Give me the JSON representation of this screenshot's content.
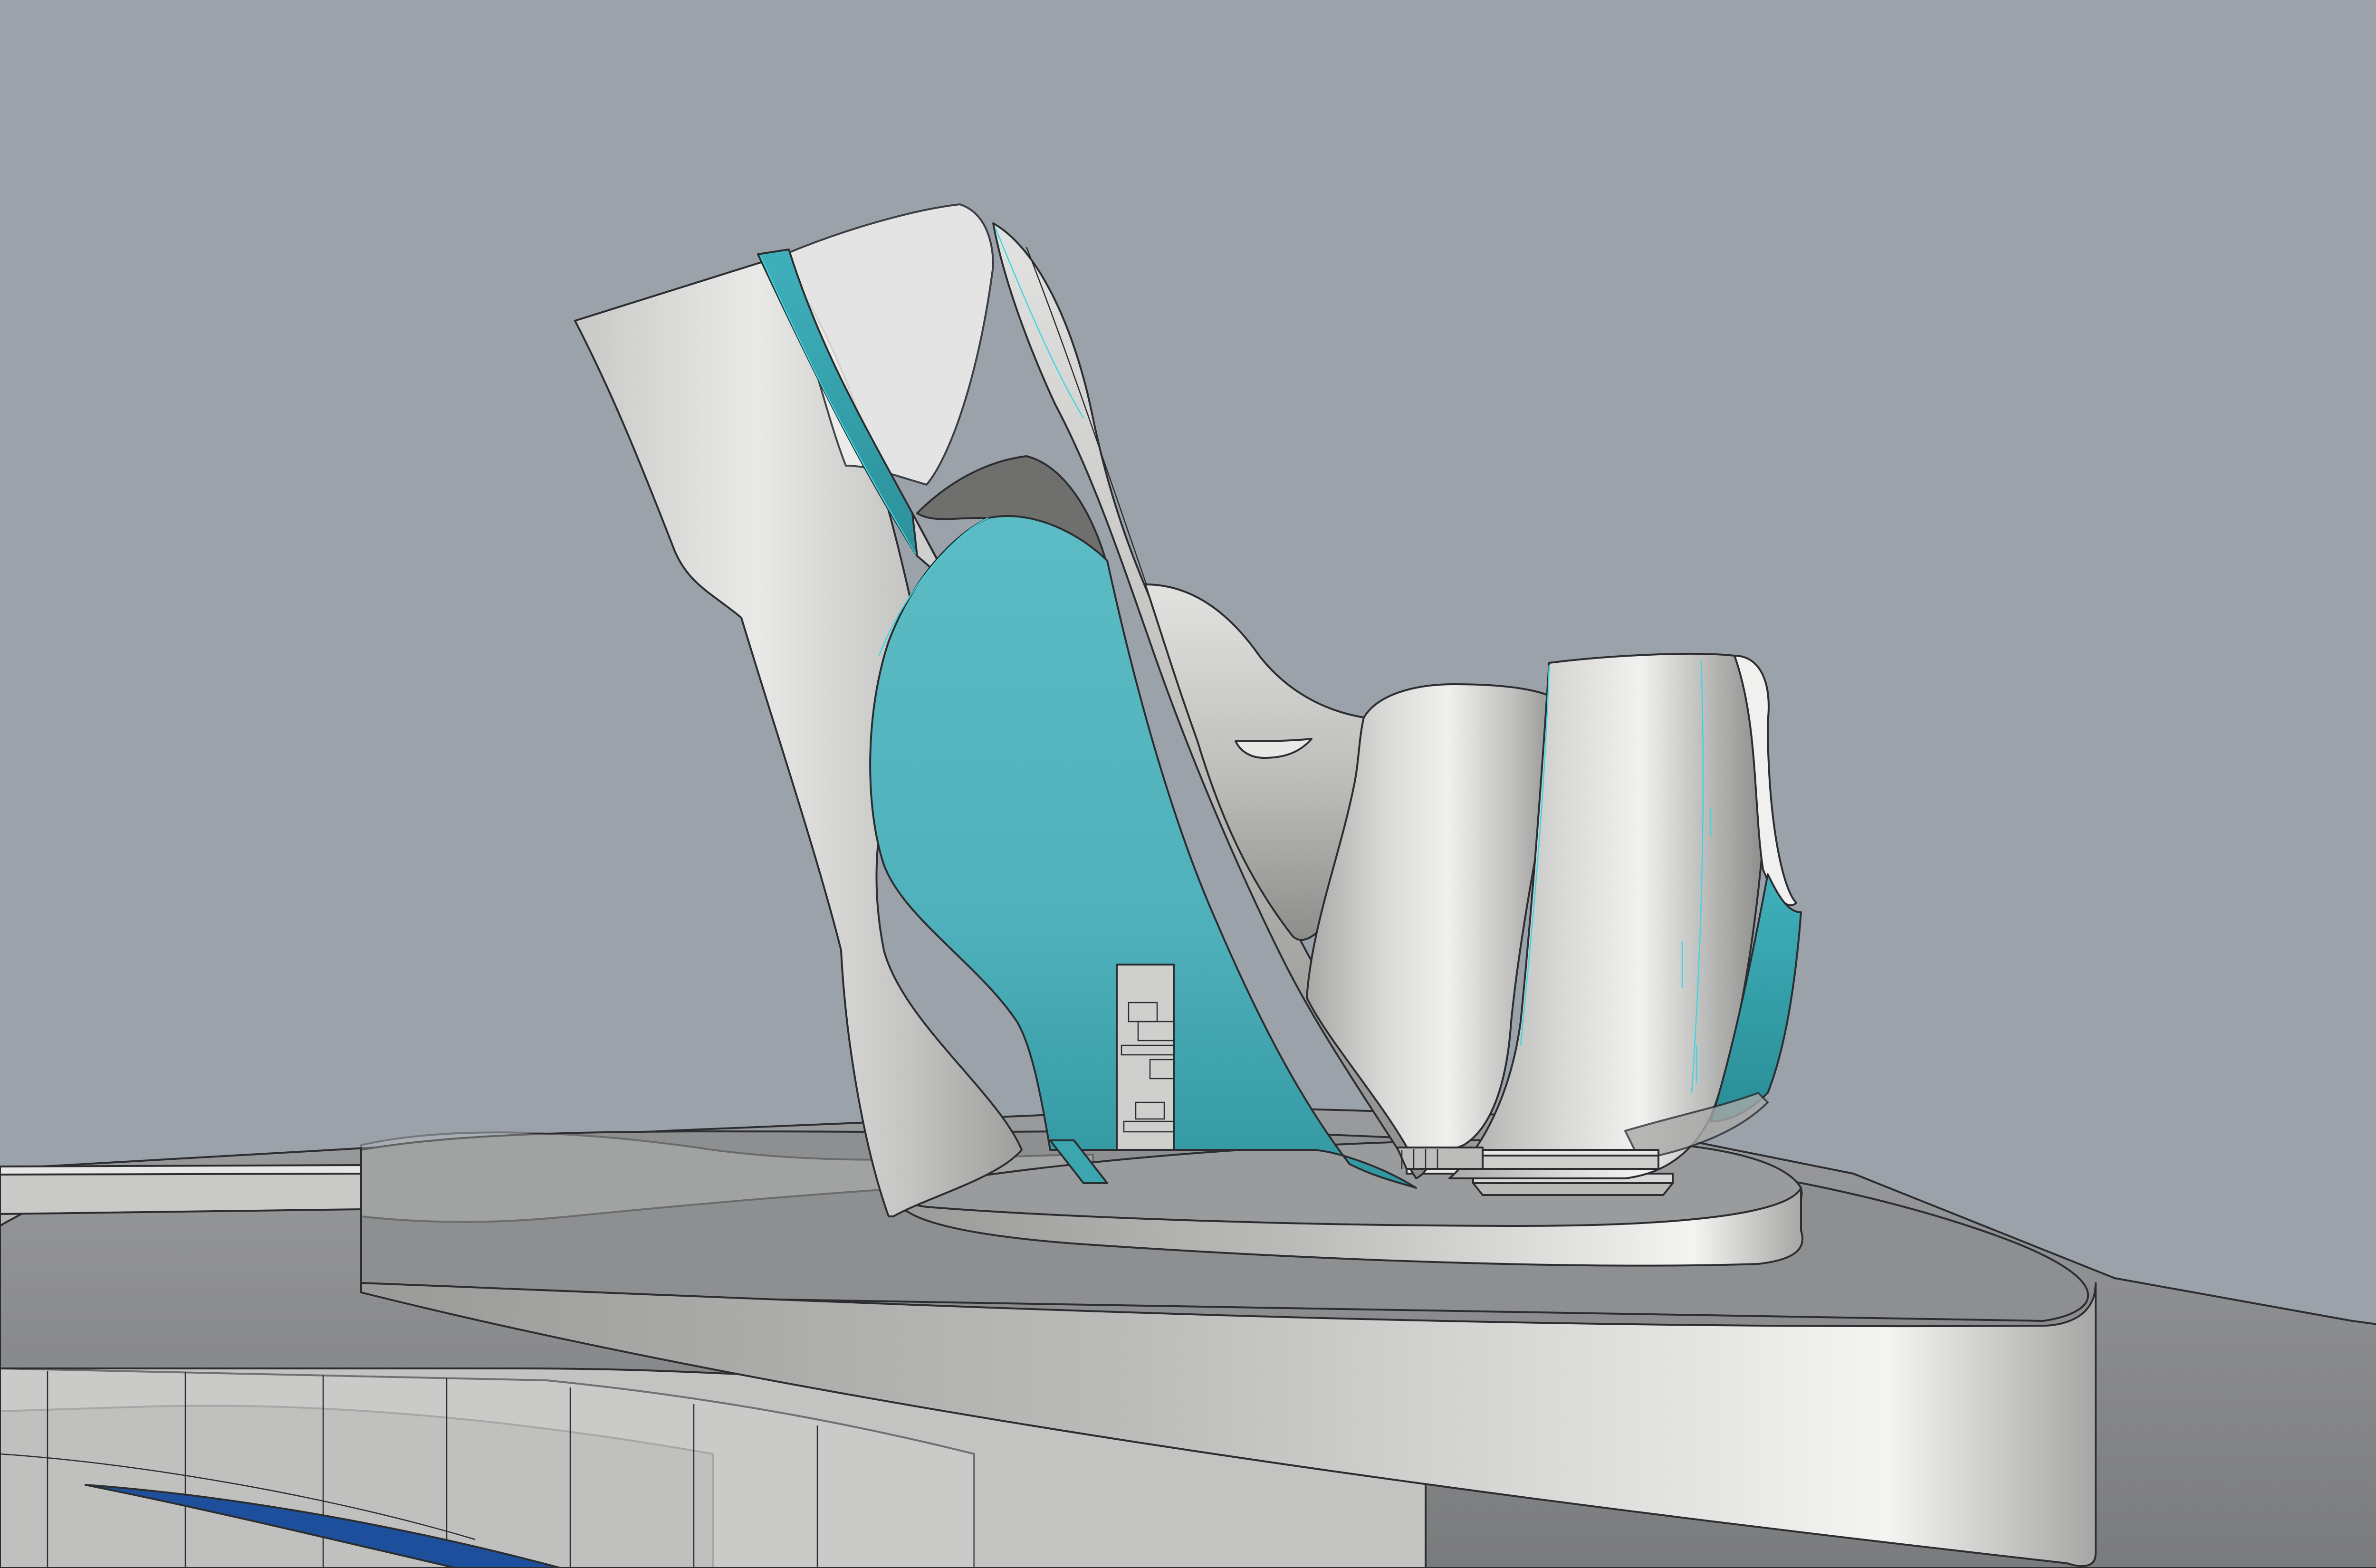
{
  "scene": {
    "kind": "3d-cad-viewport",
    "shading": "shaded-with-edges",
    "colors": {
      "background": "#9ba2aa",
      "surface_light": "#e4e4e2",
      "surface_mid": "#b9b9b6",
      "surface_dark": "#7d7d7b",
      "section_cyan": "#57bac3",
      "section_cyan_dark": "#2f9aa3",
      "accent_cyan_edge": "#3fd6e0",
      "ground": "#8e8f91",
      "water_blue": "#1e4f9c",
      "edge_line": "#2b2d30"
    }
  }
}
